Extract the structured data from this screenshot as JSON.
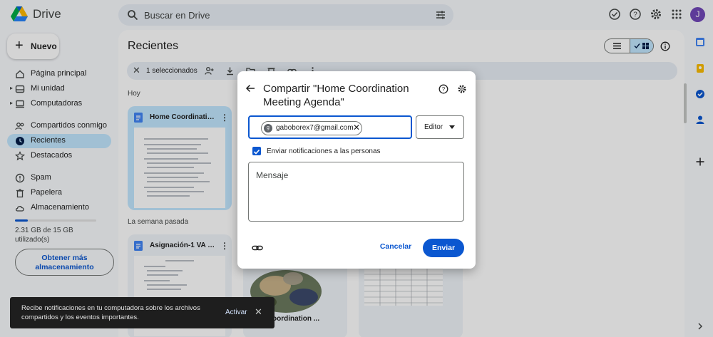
{
  "app": {
    "name": "Drive",
    "avatar_letter": "J"
  },
  "search": {
    "placeholder": "Buscar en Drive"
  },
  "sidebar": {
    "new_label": "Nuevo",
    "items": [
      {
        "label": "Página principal",
        "icon": "home-icon"
      },
      {
        "label": "Mi unidad",
        "icon": "my-drive-icon"
      },
      {
        "label": "Computadoras",
        "icon": "computer-icon"
      },
      {
        "label": "Compartidos conmigo",
        "icon": "shared-icon"
      },
      {
        "label": "Recientes",
        "icon": "clock-icon",
        "active": true
      },
      {
        "label": "Destacados",
        "icon": "star-icon"
      },
      {
        "label": "Spam",
        "icon": "spam-icon"
      },
      {
        "label": "Papelera",
        "icon": "trash-icon"
      },
      {
        "label": "Almacenamiento",
        "icon": "cloud-icon"
      }
    ],
    "storage_text": "2.31 GB de 15 GB utilizado(s)",
    "storage_fraction": 0.154,
    "more_storage": "Obtener más almacenamiento"
  },
  "main": {
    "title": "Recientes",
    "selection_text": "1 seleccionados",
    "section_today": "Hoy",
    "section_last_week": "La semana pasada",
    "files": [
      {
        "name": "Home Coordination...",
        "selected": true
      },
      {
        "name": "Asignación-1 VA Fe..."
      }
    ],
    "bottom_name": "oordination ..."
  },
  "dialog": {
    "title": "Compartir \"Home Coordination Meeting Agenda\"",
    "chip_email": "gaboborex7@gmail.com",
    "chip_avatar": "g",
    "role": "Editor",
    "notify_label": "Enviar notificaciones a las personas",
    "notify_checked": true,
    "message_placeholder": "Mensaje",
    "cancel": "Cancelar",
    "send": "Enviar"
  },
  "snackbar": {
    "text": "Recibe notificaciones en tu computadora sobre los archivos compartidos y los eventos importantes.",
    "action": "Activar"
  },
  "colors": {
    "accent": "#0b57d0",
    "selected": "#c2e7ff",
    "avatar": "#7248b9"
  }
}
